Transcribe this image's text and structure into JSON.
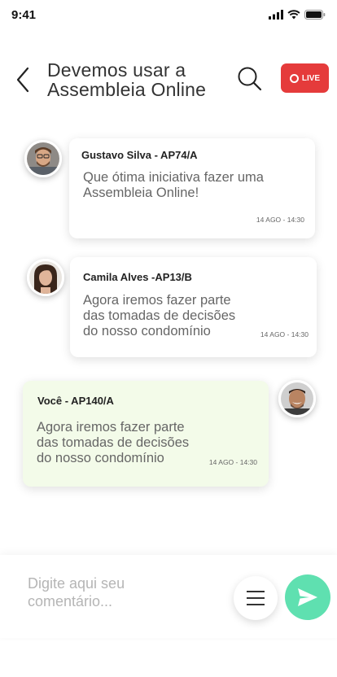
{
  "status_bar": {
    "time": "9:41"
  },
  "header": {
    "title": "Devemos usar a Assembleia Online",
    "live_label": "LIVE"
  },
  "messages": [
    {
      "author": "Gustavo Silva  - AP74/A",
      "text": "Que ótima iniciativa fazer uma Assembleia Online!",
      "time": "14 AGO - 14:30"
    },
    {
      "author": "Camila Alves -AP13/B",
      "text": "Agora iremos fazer parte das tomadas de decisões do nosso condomínio",
      "time": "14 AGO - 14:30"
    },
    {
      "author": "Você - AP140/A",
      "text": "Agora iremos fazer parte das tomadas de decisões do nosso condomínio",
      "time": "14 AGO - 14:30"
    }
  ],
  "composer": {
    "placeholder": "Digite aqui seu comentário..."
  },
  "colors": {
    "live": "#e53b3b",
    "send": "#5fe0b0",
    "own_message_bg": "#f3fbe9"
  }
}
